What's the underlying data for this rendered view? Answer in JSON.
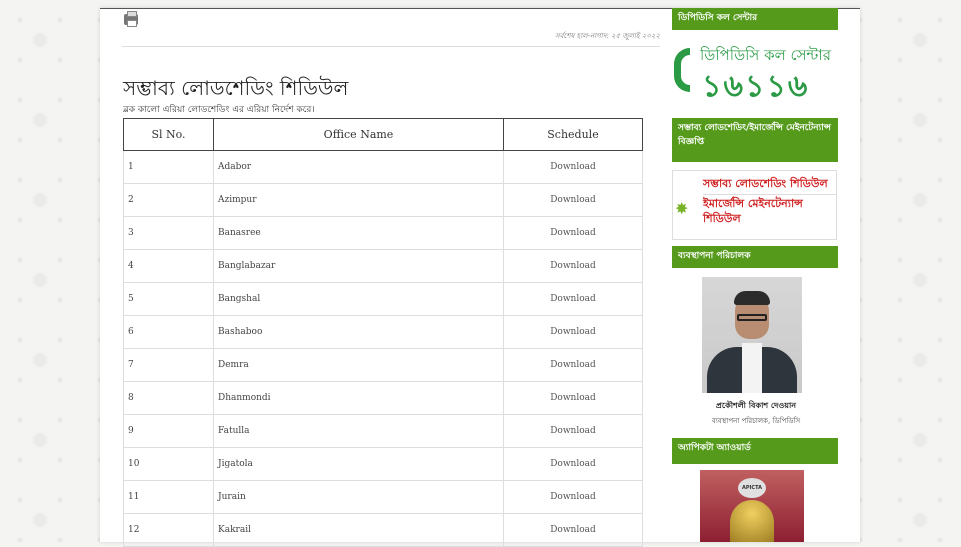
{
  "main": {
    "print_label": "Print",
    "last_update": "সর্বশেষ হাল-নাগাদ: ২৫ জুলাই ২০২২",
    "title": "সম্ভাব্য লোডশেডিং শিডিউল",
    "subtitle": "ব্লক কালো এরিয়া লোডশেডিং এর এরিয়া নির্দেশ করে।",
    "table": {
      "headers": [
        "Sl No.",
        "Office Name",
        "Schedule"
      ],
      "rows": [
        {
          "sl": "1",
          "office": "Adabor",
          "schedule": "Download"
        },
        {
          "sl": "2",
          "office": "Azimpur",
          "schedule": "Download"
        },
        {
          "sl": "3",
          "office": "Banasree",
          "schedule": "Download"
        },
        {
          "sl": "4",
          "office": "Banglabazar",
          "schedule": "Download"
        },
        {
          "sl": "5",
          "office": "Bangshal",
          "schedule": "Download"
        },
        {
          "sl": "6",
          "office": "Bashaboo",
          "schedule": "Download"
        },
        {
          "sl": "7",
          "office": "Demra",
          "schedule": "Download"
        },
        {
          "sl": "8",
          "office": "Dhanmondi",
          "schedule": "Download"
        },
        {
          "sl": "9",
          "office": "Fatulla",
          "schedule": "Download"
        },
        {
          "sl": "10",
          "office": "Jigatola",
          "schedule": "Download"
        },
        {
          "sl": "11",
          "office": "Jurain",
          "schedule": "Download"
        },
        {
          "sl": "12",
          "office": "Kakrail",
          "schedule": "Download"
        }
      ]
    }
  },
  "sidebar": {
    "callcenter_title": "ডিপিডিসি কল সেন্টার",
    "callcenter_label": "ডিপিডিসি কল সেন্টার",
    "callcenter_number": "১৬১১৬",
    "notice_title": "সম্ভাব্য লোডশেডিং/ইমার্জেন্সি মেইনটেন্যান্স বিজ্ঞপ্তি",
    "notice_links": [
      "সম্ভাব্য লোডশেডিং শিডিউল",
      "ইমার্জেন্সি মেইনটেন্যান্স শিডিউল"
    ],
    "md_title": "ব্যবস্থাপনা পরিচালক",
    "md_name": "প্রকৌশলী বিকাশ দেওয়ান",
    "md_role": "ব্যবস্থাপনা পরিচালক, ডিপিডিসি",
    "award_title": "অ্যাপিকটা অ্যাওয়ার্ড",
    "award_badge": "APICTA"
  },
  "colors": {
    "widget_green": "#559a1a",
    "callcenter_green": "#2a9a45",
    "notice_red": "#d01f1f"
  }
}
